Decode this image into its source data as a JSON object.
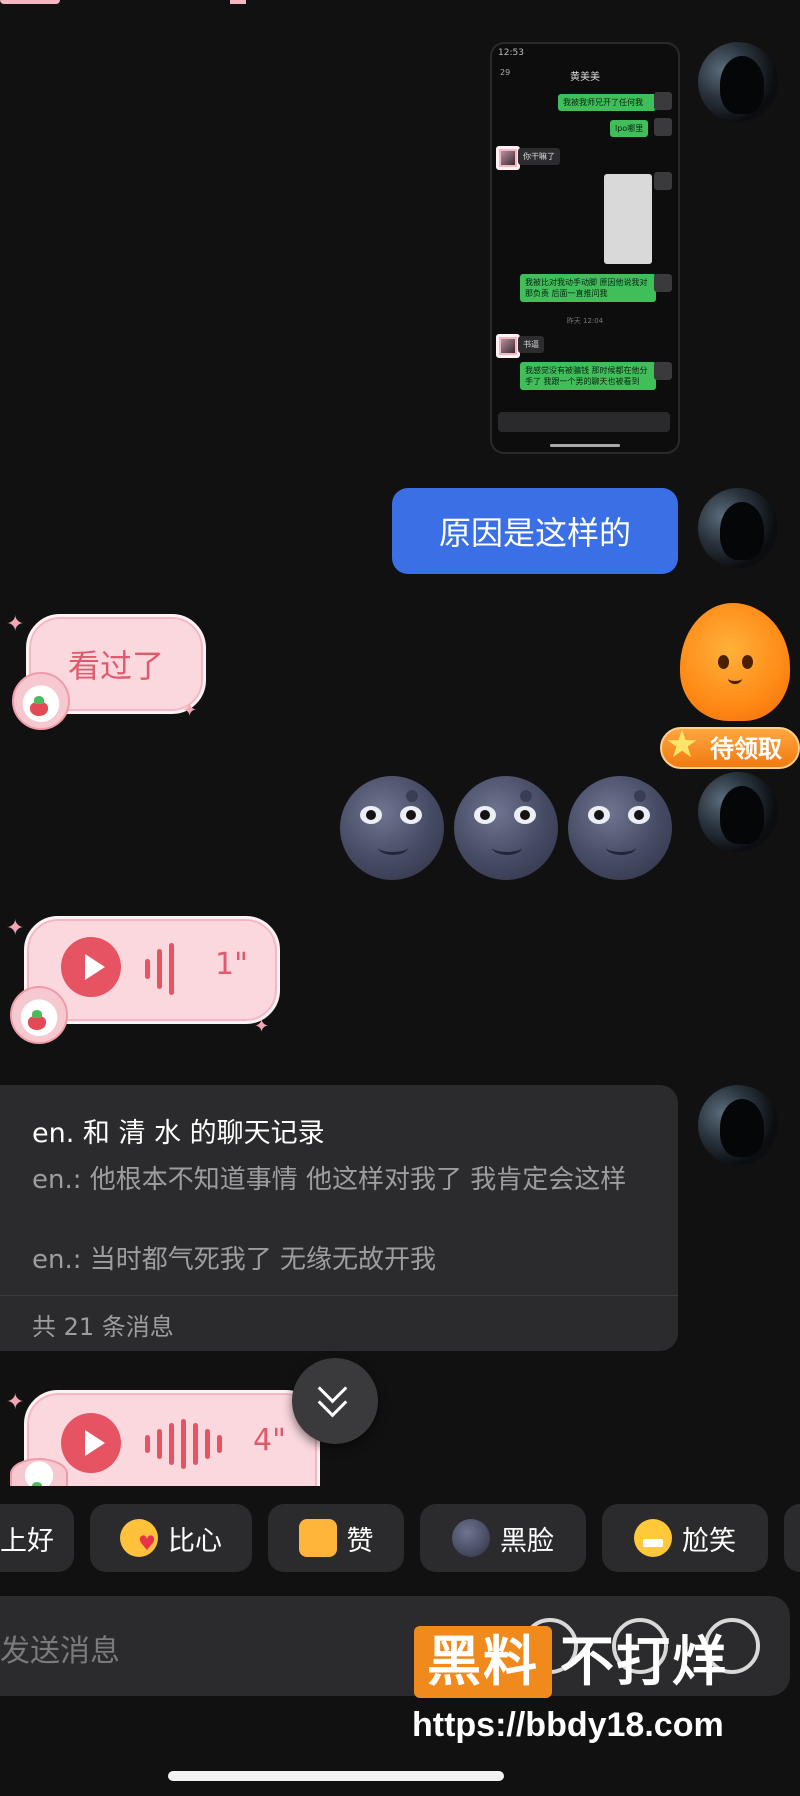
{
  "messages": {
    "image_shot": {
      "status_time": "12:53",
      "contact_name": "黄美美",
      "back_count": "29",
      "bubbles": [
        "我被我师兄开了任何我",
        "lpo哪里",
        "你干嘛了",
        "我被比对我动手动脚 原因他说我对那负责 后面一直推问我",
        "书逼",
        "我感觉没有被骗钱 那时候都在他分手了 我跟一个男的聊天也被看到"
      ],
      "time_label": "昨天 12:04"
    },
    "outgoing_text": "原因是这样的",
    "incoming_text": "看过了",
    "voice_1_duration": "1\"",
    "chat_record": {
      "title": "en. 和 清 水 的聊天记录",
      "line1": "en.: 他根本不知道事情 他这样对我了 我肯定会这样",
      "line2": "en.: 当时都气死我了 无缘无故开我",
      "footer": "共 21 条消息"
    },
    "voice_2_duration": "4\""
  },
  "badge": {
    "label": "待领取"
  },
  "quick_reactions": [
    {
      "label": "上好"
    },
    {
      "label": "比心",
      "icon": "heart-hands-icon"
    },
    {
      "label": "赞",
      "icon": "thumbs-up-icon"
    },
    {
      "label": "黑脸",
      "icon": "moon-face-icon"
    },
    {
      "label": "尬笑",
      "icon": "grin-sweat-icon"
    }
  ],
  "input": {
    "placeholder": "发送消息"
  },
  "watermark": {
    "box_text": "黑料",
    "text": "不打烊",
    "url": "https://bbdy18.com"
  },
  "colors": {
    "background": "#111112",
    "blue_bubble": "#3b6fe6",
    "pink_bubble": "#fbd8de",
    "accent_red": "#e65463",
    "badge_orange": "#f07a10",
    "card": "#2b2b2d"
  }
}
